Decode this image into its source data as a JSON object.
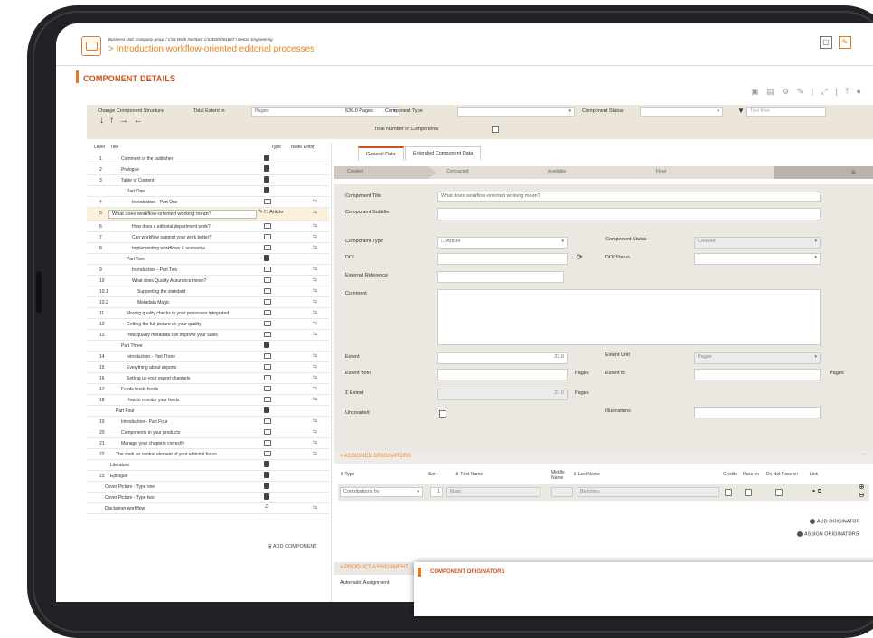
{
  "header": {
    "breadcrumb": "Business Unit: Company group / CS3 Work Number: CS3D9/0001847 / Demo: Engineering",
    "title": "> Introduction workflow-oriented editorial processes"
  },
  "section": {
    "title": "COMPONENT DETAILS"
  },
  "structure_bar": {
    "change_label": "Change Component Structure",
    "total_extent_label": "Total Extent in",
    "total_extent_unit": "Pages",
    "total_pages": "636.0 Pages",
    "component_type_label": "Component Type",
    "component_status_label": "Component Status",
    "text_filter_placeholder": "Text filter",
    "total_components_label": "Total Number of Components"
  },
  "tree": {
    "headers": {
      "level": "Level",
      "title": "Title",
      "type": "Type",
      "node": "Node",
      "entity": "Entity"
    },
    "rows": [
      {
        "level": "1",
        "title": "Comment of the publisher",
        "type": "doc",
        "indent": 0
      },
      {
        "level": "2",
        "title": "Prologue",
        "type": "doc",
        "indent": 0
      },
      {
        "level": "3",
        "title": "Table of Content",
        "type": "doc",
        "indent": 0
      },
      {
        "level": "",
        "title": "Part One",
        "type": "doc",
        "indent": 1
      },
      {
        "level": "4",
        "title": "Introduction - Part One",
        "type": "art",
        "indent": 2,
        "entity": true
      },
      {
        "level": "5",
        "title": "What does workflow-oriented working mean?",
        "type": "selected",
        "indent": 0,
        "entity": true,
        "type_label": "Article"
      },
      {
        "level": "6",
        "title": "How does a editorial department work?",
        "type": "art",
        "indent": 2,
        "entity": true
      },
      {
        "level": "7",
        "title": "Can workflow support your work better?",
        "type": "art",
        "indent": 2,
        "entity": true
      },
      {
        "level": "8",
        "title": "Implementing workflows & scenarios",
        "type": "art",
        "indent": 2,
        "entity": true
      },
      {
        "level": "",
        "title": "Part Two",
        "type": "doc",
        "indent": 1
      },
      {
        "level": "9",
        "title": "Introduction - Part Two",
        "type": "art",
        "indent": 2,
        "entity": true
      },
      {
        "level": "10",
        "title": "What does Quality Assurance mean?",
        "type": "art",
        "indent": 2,
        "entity": true
      },
      {
        "level": "10.1",
        "title": "Supporting the standard",
        "type": "art",
        "indent": 3,
        "entity": true
      },
      {
        "level": "10.2",
        "title": "Metadata Magic",
        "type": "art",
        "indent": 3,
        "entity": true
      },
      {
        "level": "11",
        "title": "Moving quality checks in your processes integrated",
        "type": "art",
        "indent": 1,
        "entity": true
      },
      {
        "level": "12",
        "title": "Getting the full picture on your quality",
        "type": "art",
        "indent": 1,
        "entity": true
      },
      {
        "level": "13",
        "title": "How quality metadata can improve your sales",
        "type": "art",
        "indent": 1,
        "entity": true
      },
      {
        "level": "",
        "title": "Part Three",
        "type": "doc",
        "indent": 0
      },
      {
        "level": "14",
        "title": "Introduction - Part Three",
        "type": "art",
        "indent": 1,
        "entity": true
      },
      {
        "level": "15",
        "title": "Everything about exports",
        "type": "art",
        "indent": 1,
        "entity": true
      },
      {
        "level": "16",
        "title": "Setting up your export channels",
        "type": "art",
        "indent": 1,
        "entity": true
      },
      {
        "level": "17",
        "title": "Feeds feeds feeds",
        "type": "art",
        "indent": 0,
        "entity": true
      },
      {
        "level": "18",
        "title": "How to monitor your feeds",
        "type": "art",
        "indent": 1,
        "entity": true
      },
      {
        "level": "",
        "title": "Part Four",
        "type": "doc",
        "indent": -1
      },
      {
        "level": "19",
        "title": "Introduction - Part Four",
        "type": "art",
        "indent": 0,
        "entity": true
      },
      {
        "level": "20",
        "title": "Components in your products",
        "type": "art",
        "indent": 0,
        "entity": true
      },
      {
        "level": "21",
        "title": "Manage your chapters correctly",
        "type": "art",
        "indent": 0,
        "entity": true
      },
      {
        "level": "22",
        "title": "The work as central element of your editorial focus",
        "type": "art",
        "indent": -1,
        "entity": true
      },
      {
        "level": "",
        "title": "Literature",
        "type": "doc",
        "indent": -2
      },
      {
        "level": "23",
        "title": "Epilogue",
        "type": "doc",
        "indent": -2
      },
      {
        "level": "",
        "title": "Cover Picture - Type one",
        "type": "doc",
        "indent": -3
      },
      {
        "level": "",
        "title": "Cover Picture - Type two",
        "type": "doc",
        "indent": -3
      },
      {
        "level": "",
        "title": "Disclaimer workflow",
        "type": "mus",
        "indent": -3,
        "entity": true
      }
    ],
    "add_component": "ADD COMPONENT"
  },
  "tabs": [
    "General Data",
    "Extended Component Data"
  ],
  "workflow": [
    "Created",
    "Contracted",
    "Available",
    "Final"
  ],
  "form": {
    "component_title_label": "Component Title",
    "component_title_value": "What does workflow-oriented working mean?",
    "component_subtitle_label": "Component Subtitle",
    "component_type_label": "Component Type",
    "component_type_value": "Article",
    "component_status_label": "Component Status",
    "component_status_value": "Created",
    "doi_label": "DOI",
    "doi_status_label": "DOI Status",
    "external_reference_label": "External Reference",
    "comment_label": "Comment",
    "extent_label": "Extent",
    "extent_value": "23.0",
    "extent_unit_label": "Extent Unit",
    "extent_unit_value": "Pages",
    "extent_from_label": "Extent from",
    "pages_label": "Pages",
    "extent_to_label": "Extent to",
    "sigma_extent_label": "Σ Extent",
    "sigma_extent_value": "23.0",
    "uncounted_label": "Uncounted",
    "illustrations_label": "Illustrations"
  },
  "originators": {
    "section_label": "> ASSIGNED ORIGINATORS",
    "headers": [
      "Type",
      "Sort",
      "First Name",
      "Middle Name",
      "Last Name",
      "Credits",
      "Pass on",
      "Do Not Pass on",
      "Link"
    ],
    "row": {
      "type": "Contributions by",
      "sort": "1",
      "first_name": "Maxi",
      "last_name": "Beilstreu"
    },
    "add_originator": "ADD ORIGINATOR",
    "assign_originators": "ASSIGN ORIGINATORS"
  },
  "product": {
    "section_label": "> PRODUCT ASSIGNMENT",
    "automatic_label": "Automatic Assignment"
  },
  "popup": {
    "title": "COMPONENT ORIGINATORS"
  },
  "colors": {
    "accent": "#c8531c",
    "orange": "#e37b24",
    "panel": "#ebe7e1"
  }
}
